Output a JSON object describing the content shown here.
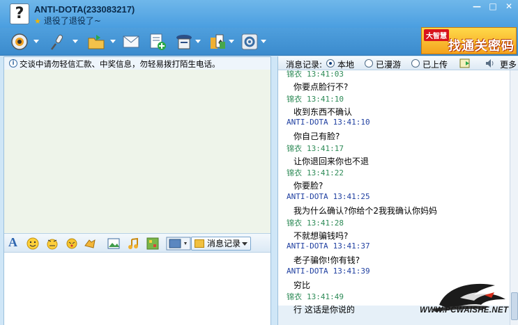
{
  "window": {
    "contact_name": "ANTI-DOTA(233083217)",
    "status_message": "退役了退役了~",
    "avatar_glyph": "?",
    "controls": {
      "minimize": "—",
      "maximize": "□",
      "close": "✕"
    }
  },
  "toolbar": {
    "items": [
      {
        "name": "video-icon"
      },
      {
        "name": "voice-icon"
      },
      {
        "name": "file-transfer-icon"
      },
      {
        "name": "send-mail-icon"
      },
      {
        "name": "create-group-icon"
      },
      {
        "name": "remote-assist-icon"
      },
      {
        "name": "app-icon"
      },
      {
        "name": "settings-icon"
      }
    ],
    "ad": {
      "brand": "大智慧",
      "text": "找通关密码"
    }
  },
  "left_panel": {
    "notice": "交谈中请勿轻信汇款、中奖信息，勿轻易拨打陌生电话。",
    "input_toolbar": {
      "font_label": "A",
      "history_button": "消息记录"
    }
  },
  "history": {
    "label": "消息记录:",
    "options": [
      {
        "label": "本地",
        "selected": true
      },
      {
        "label": "已漫游",
        "selected": false
      },
      {
        "label": "已上传",
        "selected": false
      }
    ],
    "more": "更多"
  },
  "messages": [
    {
      "sender": "锦衣",
      "time": "13:41:03",
      "text": "你要点脸行不?"
    },
    {
      "sender": "锦衣",
      "time": "13:41:10",
      "text": "收到东西不确认"
    },
    {
      "sender": "ANTI-DOTA",
      "time": "13:41:10",
      "text": "你自己有脸?"
    },
    {
      "sender": "锦衣",
      "time": "13:41:17",
      "text": "让你退回来你也不退"
    },
    {
      "sender": "锦衣",
      "time": "13:41:22",
      "text": "你要脸?"
    },
    {
      "sender": "ANTI-DOTA",
      "time": "13:41:25",
      "text": "我为什么确认?你给个2我我确认你妈妈"
    },
    {
      "sender": "锦衣",
      "time": "13:41:28",
      "text": "不就想骗钱吗?"
    },
    {
      "sender": "ANTI-DOTA",
      "time": "13:41:37",
      "text": "老子骗你!你有钱?"
    },
    {
      "sender": "ANTI-DOTA",
      "time": "13:41:39",
      "text": "穷比"
    },
    {
      "sender": "锦衣",
      "time": "13:41:49",
      "text": "行 这话是你说的"
    }
  ],
  "colors": {
    "sender_self": "#2e8b57",
    "sender_other": "#1f3fa0"
  },
  "watermark": "WWW.PCWAISHE.NET"
}
